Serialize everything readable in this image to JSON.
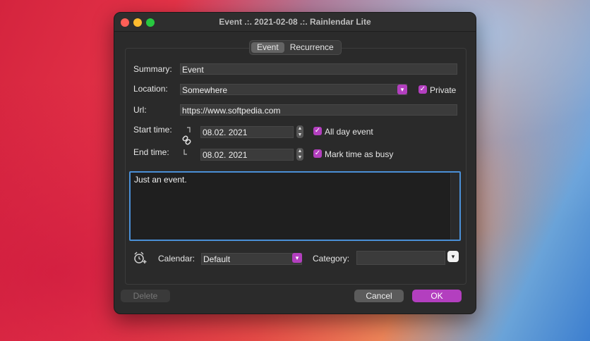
{
  "window": {
    "title": "Event .:. 2021-02-08 .:. Rainlendar Lite"
  },
  "tabs": [
    {
      "label": "Event",
      "active": true
    },
    {
      "label": "Recurrence",
      "active": false
    }
  ],
  "form": {
    "summary_label": "Summary:",
    "summary_value": "Event",
    "location_label": "Location:",
    "location_value": "Somewhere",
    "private_label": "Private",
    "url_label": "Url:",
    "url_value": "https://www.softpedia.com",
    "start_label": "Start time:",
    "start_value": "08.02. 2021",
    "end_label": "End time:",
    "end_value": "08.02. 2021",
    "all_day_label": "All day event",
    "busy_label": "Mark time as busy",
    "notes_value": "Just an event."
  },
  "bottom": {
    "calendar_label": "Calendar:",
    "calendar_value": "Default",
    "category_label": "Category:",
    "category_value": ""
  },
  "buttons": {
    "delete": "Delete",
    "cancel": "Cancel",
    "ok": "OK"
  },
  "icons": {
    "link": "link-icon",
    "alarm": "alarm-clock-icon",
    "chevron": "chevron-down-icon",
    "check": "checkmark-icon"
  },
  "colors": {
    "accent": "#b33fbf",
    "focus": "#4a8fd6"
  }
}
